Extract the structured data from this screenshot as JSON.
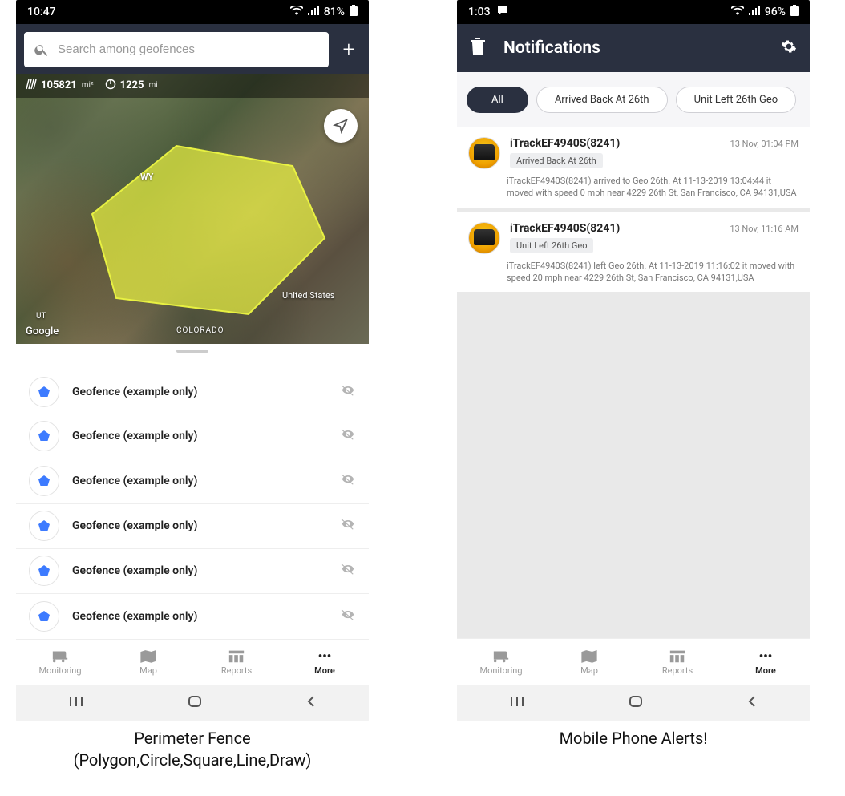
{
  "left": {
    "status": {
      "time": "10:47",
      "battery": "81%"
    },
    "search": {
      "placeholder": "Search among geofences"
    },
    "map": {
      "area_value": "105821",
      "area_unit": "mi²",
      "perim_value": "1225",
      "perim_unit": "mi",
      "labels": {
        "wy": "WY",
        "us": "United States",
        "co": "COLORADO",
        "ut": "UT",
        "google": "Google"
      }
    },
    "geofences": [
      {
        "label": "Geofence (example only)"
      },
      {
        "label": "Geofence (example only)"
      },
      {
        "label": "Geofence (example only)"
      },
      {
        "label": "Geofence (example only)"
      },
      {
        "label": "Geofence (example only)"
      },
      {
        "label": "Geofence (example only)"
      }
    ],
    "caption_line1": "Perimeter Fence",
    "caption_line2": "(Polygon,Circle,Square,Line,Draw)"
  },
  "right": {
    "status": {
      "time": "1:03",
      "battery": "96%"
    },
    "header": {
      "title": "Notifications"
    },
    "chips": [
      {
        "label": "All",
        "active": true
      },
      {
        "label": "Arrived Back At 26th"
      },
      {
        "label": "Unit Left 26th Geo"
      }
    ],
    "notifs": [
      {
        "name": "iTrackEF4940S(8241)",
        "tag": "Arrived Back At 26th",
        "time": "13 Nov, 01:04 PM",
        "desc": "iTrackEF4940S(8241) arrived to Geo 26th.    At 11-13-2019 13:04:44 it moved with speed 0 mph near 4229 26th St, San Francisco, CA 94131,USA"
      },
      {
        "name": "iTrackEF4940S(8241)",
        "tag": "Unit Left 26th Geo",
        "time": "13 Nov, 11:16 AM",
        "desc": "iTrackEF4940S(8241) left Geo 26th.    At 11-13-2019 11:16:02 it moved with speed 20 mph near 4229 26th St, San Francisco, CA 94131,USA"
      }
    ],
    "caption": "Mobile Phone Alerts!"
  },
  "nav": {
    "items": [
      {
        "label": "Monitoring"
      },
      {
        "label": "Map"
      },
      {
        "label": "Reports"
      },
      {
        "label": "More",
        "active": true
      }
    ]
  }
}
